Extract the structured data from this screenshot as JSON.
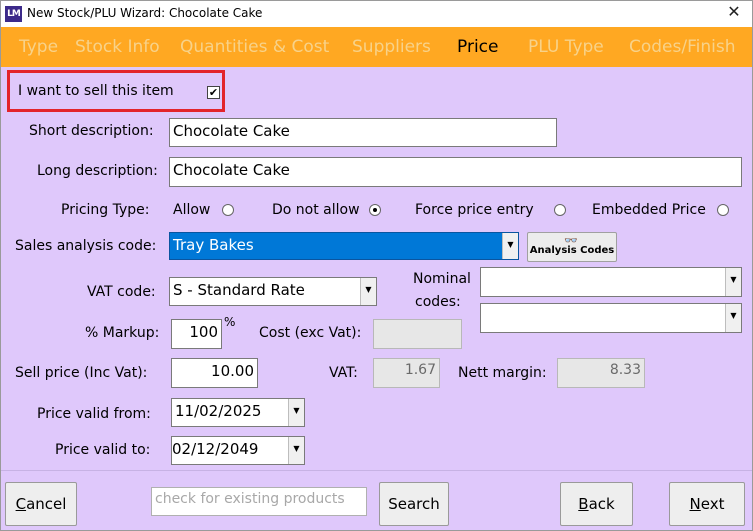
{
  "window": {
    "app_icon_text": "LM",
    "title": "New Stock/PLU Wizard: Chocolate Cake",
    "close_glyph": "✕"
  },
  "tabs": [
    {
      "label": "Type",
      "active": false
    },
    {
      "label": "Stock Info",
      "active": false
    },
    {
      "label": "Quantities & Cost",
      "active": false
    },
    {
      "label": "Suppliers",
      "active": false
    },
    {
      "label": "Price",
      "active": true
    },
    {
      "label": "PLU Type",
      "active": false
    },
    {
      "label": "Codes/Finish",
      "active": false
    }
  ],
  "sell_item": {
    "label": "I want to sell this item",
    "checked": true,
    "check_glyph": "✔"
  },
  "short_description": {
    "label": "Short description:",
    "value": "Chocolate Cake"
  },
  "long_description": {
    "label": "Long description:",
    "value": "Chocolate Cake"
  },
  "pricing_type": {
    "label": "Pricing Type:",
    "options": [
      {
        "label": "Allow",
        "selected": false
      },
      {
        "label": "Do not allow",
        "selected": true
      },
      {
        "label": "Force price entry",
        "selected": false
      },
      {
        "label": "Embedded Price",
        "selected": false
      }
    ]
  },
  "sales_analysis": {
    "label": "Sales analysis code:",
    "value": "Tray Bakes",
    "button_label": "Analysis Codes",
    "button_icon": "glasses-icon"
  },
  "vat_code": {
    "label": "VAT code:",
    "value": "S - Standard Rate"
  },
  "nominal_codes": {
    "label_line1": "Nominal",
    "label_line2": "codes:",
    "value1": "",
    "value2": ""
  },
  "markup": {
    "label": "% Markup:",
    "value": "100",
    "suffix": "%"
  },
  "cost": {
    "label": "Cost (exc Vat):",
    "value": ""
  },
  "sell_price": {
    "label": "Sell price (Inc Vat):",
    "value": "10.00"
  },
  "vat": {
    "label": "VAT:",
    "value": "1.67"
  },
  "nett_margin": {
    "label": "Nett margin:",
    "value": "8.33"
  },
  "price_valid_from": {
    "label": "Price valid from:",
    "value": "11/02/2025"
  },
  "price_valid_to": {
    "label": "Price valid to:",
    "value": "02/12/2049"
  },
  "footer": {
    "cancel_prefix": "",
    "cancel_underline": "C",
    "cancel_rest": "ancel",
    "search_placeholder": "check for existing products",
    "search_label": "Search",
    "back_underline": "B",
    "back_rest": "ack",
    "next_underline": "N",
    "next_rest": "ext"
  },
  "colors": {
    "background": "#dfc8fb",
    "tabbar": "#ffa822",
    "tab_inactive": "#f8d289",
    "highlight_box": "#e3242b",
    "selected_combo": "#0078d7"
  }
}
